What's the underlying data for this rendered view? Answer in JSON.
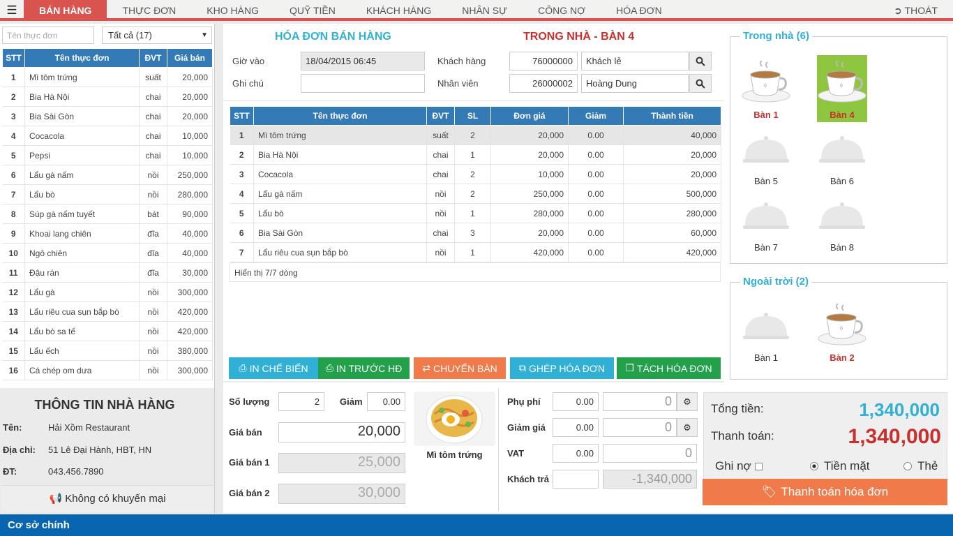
{
  "nav": {
    "menu_icon": "hamburger-icon",
    "tabs": [
      "BÁN HÀNG",
      "THỰC ĐƠN",
      "KHO HÀNG",
      "QUỸ TIỀN",
      "KHÁCH HÀNG",
      "NHÂN SỰ",
      "CÔNG NỢ",
      "HÓA ĐƠN"
    ],
    "active_tab": "BÁN HÀNG",
    "logout": "THOÁT",
    "accent_color": "#d9534f"
  },
  "menu": {
    "search_placeholder": "Tên thực đơn",
    "filter_value": "Tất cả (17)",
    "headers": [
      "STT",
      "Tên thực đơn",
      "ĐVT",
      "Giá bán"
    ],
    "items": [
      [
        "1",
        "Mì tôm trứng",
        "suất",
        "20,000"
      ],
      [
        "2",
        "Bia Hà Nội",
        "chai",
        "20,000"
      ],
      [
        "3",
        "Bia Sài Gòn",
        "chai",
        "20,000"
      ],
      [
        "4",
        "Cocacola",
        "chai",
        "10,000"
      ],
      [
        "5",
        "Pepsi",
        "chai",
        "10,000"
      ],
      [
        "6",
        "Lẩu gà nấm",
        "nồi",
        "250,000"
      ],
      [
        "7",
        "Lẩu bò",
        "nồi",
        "280,000"
      ],
      [
        "8",
        "Súp gà nấm tuyết",
        "bát",
        "90,000"
      ],
      [
        "9",
        "Khoai lang chiên",
        "đĩa",
        "40,000"
      ],
      [
        "10",
        "Ngô chiên",
        "đĩa",
        "40,000"
      ],
      [
        "11",
        "Đậu rán",
        "đĩa",
        "30,000"
      ],
      [
        "12",
        "Lẩu gà",
        "nồi",
        "300,000"
      ],
      [
        "13",
        "Lẩu riêu cua sụn bắp bò",
        "nồi",
        "420,000"
      ],
      [
        "14",
        "Lẩu bò sa tế",
        "nồi",
        "420,000"
      ],
      [
        "15",
        "Lẩu ếch",
        "nồi",
        "380,000"
      ],
      [
        "16",
        "Cá chép om dưa",
        "nồi",
        "300,000"
      ]
    ]
  },
  "restaurant": {
    "title": "THÔNG TIN NHÀ HÀNG",
    "name_label": "Tên:",
    "name": "Hải Xồm Restaurant",
    "address_label": "Địa chỉ:",
    "address": "51 Lê Đại Hành, HBT, HN",
    "phone_label": "ĐT:",
    "phone": "043.456.7890",
    "promo": "Không có khuyến mại"
  },
  "invoice": {
    "title": "HÓA ĐƠN BÁN HÀNG",
    "table_title": "TRONG NHÀ - BÀN 4",
    "time_in_label": "Giờ vào",
    "time_in": "18/04/2015 06:45",
    "note_label": "Ghi chú",
    "note": "",
    "customer_label": "Khách hàng",
    "customer_code": "76000000",
    "customer_name": "Khách lẻ",
    "staff_label": "Nhân viên",
    "staff_code": "26000002",
    "staff_name": "Hoàng Dung",
    "headers": [
      "STT",
      "Tên thực đơn",
      "ĐVT",
      "SL",
      "Đơn giá",
      "Giảm",
      "Thành tiền"
    ],
    "rows": [
      [
        "1",
        "Mì tôm trứng",
        "suất",
        "2",
        "20,000",
        "0.00",
        "40,000"
      ],
      [
        "2",
        "Bia Hà Nội",
        "chai",
        "1",
        "20,000",
        "0.00",
        "20,000"
      ],
      [
        "3",
        "Cocacola",
        "chai",
        "2",
        "10,000",
        "0.00",
        "20,000"
      ],
      [
        "4",
        "Lẩu gà nấm",
        "nồi",
        "2",
        "250,000",
        "0.00",
        "500,000"
      ],
      [
        "5",
        "Lẩu bò",
        "nồi",
        "1",
        "280,000",
        "0.00",
        "280,000"
      ],
      [
        "6",
        "Bia Sài Gòn",
        "chai",
        "3",
        "20,000",
        "0.00",
        "60,000"
      ],
      [
        "7",
        "Lẩu riêu cua sụn bắp bò",
        "nồi",
        "1",
        "420,000",
        "0.00",
        "420,000"
      ]
    ],
    "footer": "Hiển thị 7/7 dòng"
  },
  "actions": [
    {
      "label": "IN CHẾ BIẾN",
      "icon": "print-icon",
      "color": "#31b0d5"
    },
    {
      "label": "IN TRƯỚC HĐ",
      "icon": "print-icon",
      "color": "#22a14a"
    },
    {
      "label": "CHUYỂN BÀN",
      "icon": "swap-icon",
      "color": "#f07a4a"
    },
    {
      "label": "GHÉP HÓA ĐƠN",
      "icon": "merge-icon",
      "color": "#31b0d5"
    },
    {
      "label": "TÁCH HÓA ĐƠN",
      "icon": "split-icon",
      "color": "#22a14a"
    }
  ],
  "tables": {
    "indoor_title": "Trong nhà (6)",
    "indoor": [
      {
        "name": "Bàn 1",
        "occupied": true,
        "selected": false
      },
      {
        "name": "Bàn 4",
        "occupied": true,
        "selected": true
      },
      {
        "name": "Bàn 5",
        "occupied": false,
        "selected": false
      },
      {
        "name": "Bàn 6",
        "occupied": false,
        "selected": false
      },
      {
        "name": "Bàn 7",
        "occupied": false,
        "selected": false
      },
      {
        "name": "Bàn 8",
        "occupied": false,
        "selected": false
      }
    ],
    "outdoor_title": "Ngoài trời (2)",
    "outdoor": [
      {
        "name": "Bàn 1",
        "occupied": false,
        "selected": false
      },
      {
        "name": "Bàn 2",
        "occupied": true,
        "selected": false
      }
    ]
  },
  "item_detail": {
    "qty_label": "Số lượng",
    "qty": "2",
    "discount_label": "Giảm",
    "discount": "0.00",
    "price_label": "Giá bán",
    "price": "20,000",
    "price1_label": "Giá bán 1",
    "price1": "25,000",
    "price2_label": "Giá bán 2",
    "price2": "30,000",
    "item_name": "Mì tôm trứng"
  },
  "fees": {
    "surcharge_label": "Phụ phí",
    "surcharge_pct": "0.00",
    "surcharge_amt": "0",
    "discount_label": "Giảm giá",
    "discount_pct": "0.00",
    "discount_amt": "0",
    "vat_label": "VAT",
    "vat_pct": "0.00",
    "vat_amt": "0",
    "paid_label": "Khách trả",
    "paid": "",
    "change": "-1,340,000"
  },
  "totals": {
    "total_label": "Tổng tiền:",
    "total": "1,340,000",
    "pay_label": "Thanh toán:",
    "pay": "1,340,000",
    "debt_label": "Ghi nợ",
    "cash_label": "Tiền mặt",
    "card_label": "Thẻ",
    "pay_method": "Tiền mặt",
    "pay_button": "Thanh toán hóa đơn"
  },
  "status": {
    "branch": "Cơ sở chính"
  }
}
